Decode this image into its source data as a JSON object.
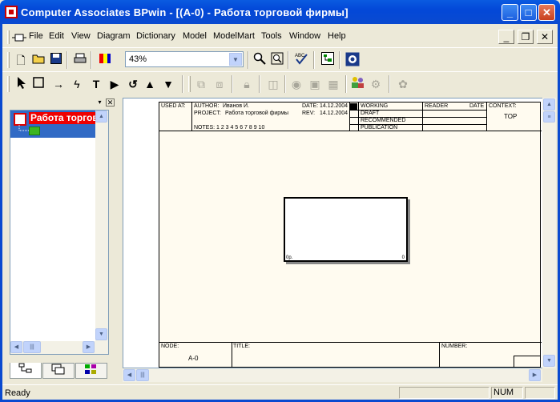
{
  "window": {
    "title": "Computer Associates BPwin - [(A-0)  - Работа торговой фирмы]",
    "buttons": {
      "minimize": "_",
      "maximize": "□",
      "close": "✕"
    }
  },
  "menu": {
    "items": [
      "File",
      "Edit",
      "View",
      "Diagram",
      "Dictionary",
      "Model",
      "ModelMart",
      "Tools",
      "Window",
      "Help"
    ],
    "mdi_buttons": {
      "minimize": "_",
      "restore": "❐",
      "close": "✕"
    }
  },
  "toolbar": {
    "zoom_value": "43%"
  },
  "model_explorer": {
    "root_label": "Работа торговой фирмы",
    "tabs": [
      "activities",
      "diagrams",
      "objects"
    ]
  },
  "diagram": {
    "header": {
      "used_at": "USED AT:",
      "author_label": "AUTHOR:",
      "author_value": "Иванов И.",
      "project_label": "PROJECT:",
      "project_value": "Работа торговой фирмы",
      "date_label": "DATE:",
      "date_value": "14.12.2004",
      "rev_label": "REV:",
      "rev_value": "14.12.2004",
      "notes": "NOTES:  1  2  3  4  5  6  7  8  9  10",
      "status": [
        "WORKING",
        "DRAFT",
        "RECOMMENDED",
        "PUBLICATION"
      ],
      "reader": "READER",
      "date": "DATE",
      "context": "CONTEXT:",
      "context_value": "TOP"
    },
    "activity": {
      "name": "",
      "number": "0",
      "cost": "0р."
    },
    "footer": {
      "node_label": "NODE:",
      "node_value": "A-0",
      "title_label": "TITLE:",
      "number_label": "NUMBER:"
    }
  },
  "status_bar": {
    "text": "Ready",
    "num": "NUM"
  }
}
